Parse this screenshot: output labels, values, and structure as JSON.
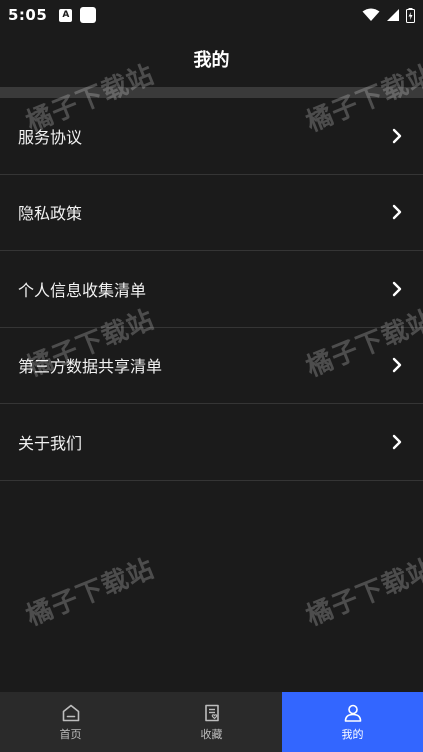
{
  "status_bar": {
    "time": "5:05",
    "notif_letter": "A"
  },
  "header": {
    "title": "我的"
  },
  "menu": {
    "items": [
      {
        "label": "服务协议"
      },
      {
        "label": "隐私政策"
      },
      {
        "label": "个人信息收集清单"
      },
      {
        "label": "第三方数据共享清单"
      },
      {
        "label": "关于我们"
      }
    ]
  },
  "watermark_text": "橘子下载站",
  "bottom_nav": {
    "tabs": [
      {
        "label": "首页",
        "icon": "home-icon"
      },
      {
        "label": "收藏",
        "icon": "favorites-icon"
      },
      {
        "label": "我的",
        "icon": "user-icon"
      }
    ],
    "active_index": 2
  },
  "colors": {
    "background": "#1b1b1b",
    "accent": "#3366ff",
    "divider": "#3a3a3a"
  }
}
